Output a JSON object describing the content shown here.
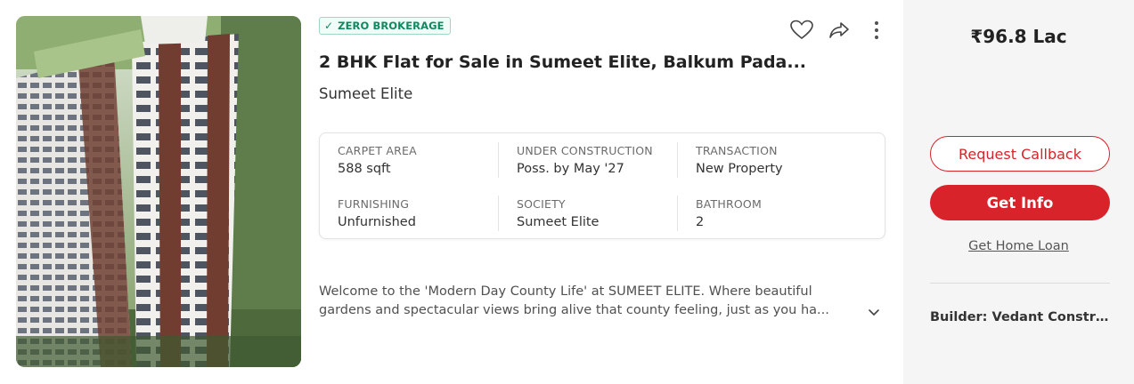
{
  "badge": {
    "icon": "check-icon",
    "label": "ZERO BROKERAGE"
  },
  "actions": [
    {
      "name": "shortlist",
      "icon": "heart-icon"
    },
    {
      "name": "share",
      "icon": "share-icon"
    },
    {
      "name": "more",
      "icon": "more-vertical-icon"
    }
  ],
  "listing": {
    "title": "2 BHK Flat for Sale in Sumeet Elite, Balkum Pada...",
    "project": "Sumeet Elite"
  },
  "specs": [
    {
      "label": "CARPET AREA",
      "value": "588 sqft"
    },
    {
      "label": "UNDER CONSTRUCTION",
      "value": "Poss. by May '27"
    },
    {
      "label": "TRANSACTION",
      "value": "New Property"
    },
    {
      "label": "FURNISHING",
      "value": "Unfurnished"
    },
    {
      "label": "SOCIETY",
      "value": "Sumeet Elite"
    },
    {
      "label": "BATHROOM",
      "value": "2"
    }
  ],
  "description": {
    "line1": "Welcome to the 'Modern Day County Life' at SUMEET ELITE. Where beautiful",
    "line2": "gardens and spectacular views bring alive that county feeling, just as you ha..."
  },
  "side": {
    "price": "₹96.8 Lac",
    "request_callback": "Request Callback",
    "get_info": "Get Info",
    "home_loan": "Get Home Loan",
    "builder": "Builder: Vedant Construc..."
  },
  "colors": {
    "accent": "#d8232a",
    "badge_green": "#0f8a5f",
    "side_bg": "#f5f5f5"
  }
}
